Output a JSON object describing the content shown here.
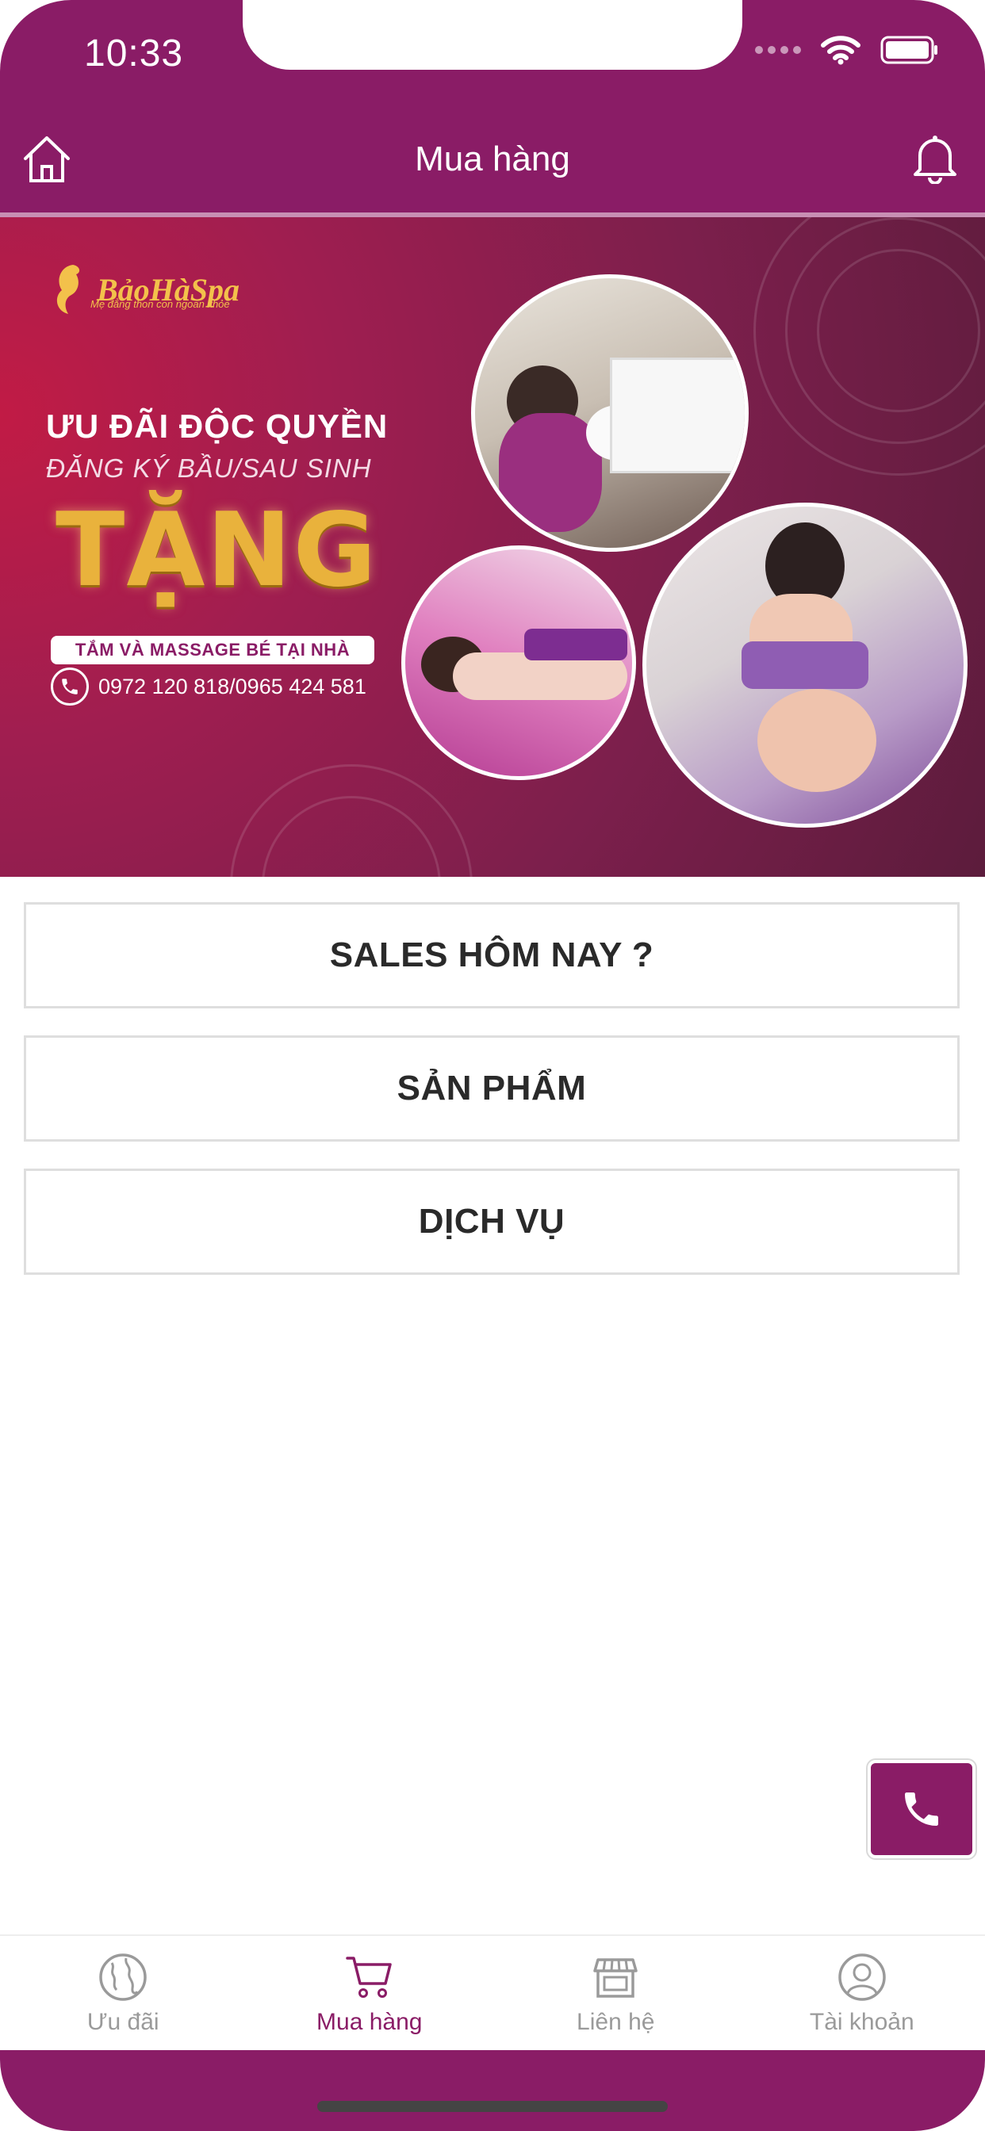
{
  "status_bar": {
    "time": "10:33"
  },
  "header": {
    "title": "Mua hàng"
  },
  "banner": {
    "logo_text": "BảoHàSpa",
    "logo_tagline": "Mẹ đẳng thon con ngoan khỏe",
    "headline": "ƯU ĐÃI ĐỘC QUYỀN",
    "subline": "ĐĂNG KÝ BẦU/SAU SINH",
    "gift": "TẶNG",
    "offer": "TẮM VÀ MASSAGE BÉ TẠI NHÀ",
    "phone": "0972 120 818/0965 424 581"
  },
  "menu": {
    "sales": "SALES HÔM NAY ?",
    "products": "SẢN PHẨM",
    "services": "DỊCH VỤ"
  },
  "tabs": [
    {
      "label": "Ưu đãi",
      "icon": "globe-icon",
      "active": false
    },
    {
      "label": "Mua hàng",
      "icon": "cart-icon",
      "active": true
    },
    {
      "label": "Liên hệ",
      "icon": "store-icon",
      "active": false
    },
    {
      "label": "Tài khoản",
      "icon": "user-icon",
      "active": false
    }
  ],
  "colors": {
    "brand": "#8a1c66",
    "gold": "#e9b23c",
    "inactive": "#9a9a9a"
  }
}
